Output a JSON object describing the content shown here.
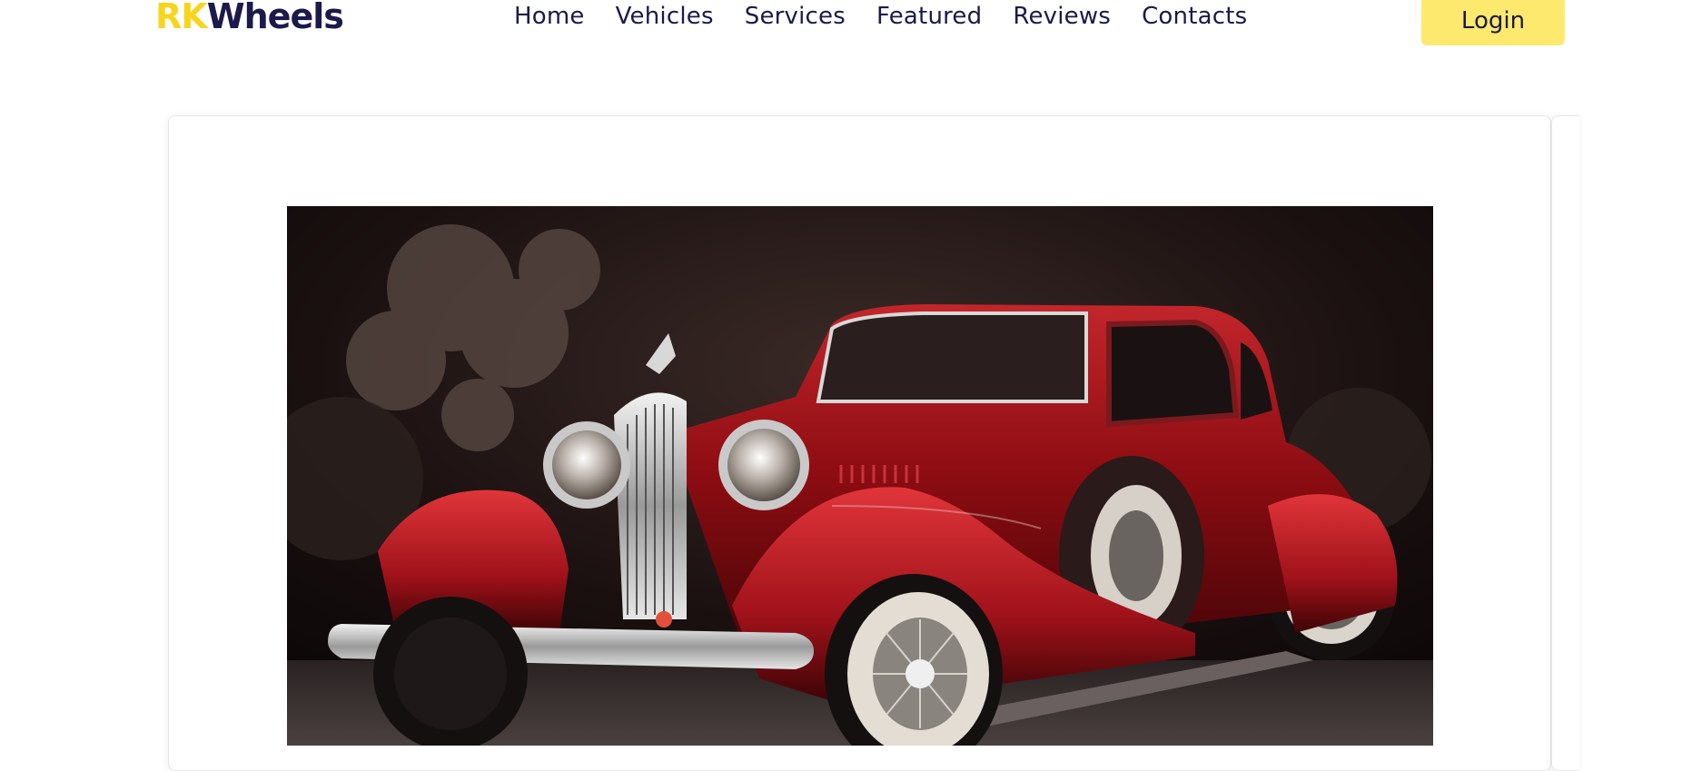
{
  "brand": {
    "part1": "RK",
    "part2": "Wheels"
  },
  "nav": {
    "items": [
      {
        "label": "Home"
      },
      {
        "label": "Vehicles"
      },
      {
        "label": "Services"
      },
      {
        "label": "Featured"
      },
      {
        "label": "Reviews"
      },
      {
        "label": "Contacts"
      }
    ],
    "login_label": "Login"
  },
  "hero": {
    "image_icon": "vintage-red-car-photo"
  },
  "colors": {
    "brand_yellow": "#f7d51c",
    "brand_navy": "#1b1a4a",
    "login_bg": "#fde96e",
    "car_red": "#9b0f14"
  }
}
